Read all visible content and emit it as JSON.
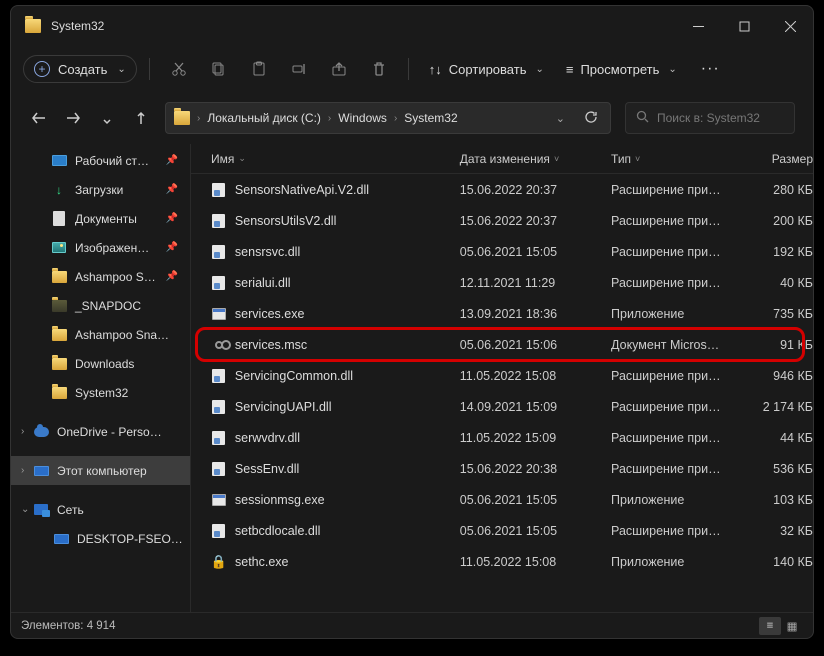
{
  "window": {
    "title": "System32"
  },
  "toolbar": {
    "new_label": "Создать",
    "sort_label": "Сортировать",
    "view_label": "Просмотреть"
  },
  "breadcrumb": {
    "items": [
      "Локальный диск (C:)",
      "Windows",
      "System32"
    ]
  },
  "search": {
    "placeholder": "Поиск в: System32"
  },
  "sidebar": {
    "items": [
      {
        "label": "Рабочий ст…",
        "icon": "desktop"
      },
      {
        "label": "Загрузки",
        "icon": "download"
      },
      {
        "label": "Документы",
        "icon": "doc"
      },
      {
        "label": "Изображен…",
        "icon": "image"
      },
      {
        "label": "Ashampoo S…",
        "icon": "folder"
      },
      {
        "label": "_SNAPDOC",
        "icon": "folder-dark"
      },
      {
        "label": "Ashampoo Sna…",
        "icon": "folder"
      },
      {
        "label": "Downloads",
        "icon": "folder"
      },
      {
        "label": "System32",
        "icon": "folder"
      }
    ],
    "onedrive": "OneDrive - Perso…",
    "thispc": "Этот компьютер",
    "network": "Сеть",
    "desktop_host": "DESKTOP-FSEO…"
  },
  "columns": {
    "name": "Имя",
    "date": "Дата изменения",
    "type": "Тип",
    "size": "Размер"
  },
  "files": [
    {
      "name": "SensorsNativeApi.V2.dll",
      "date": "15.06.2022 20:37",
      "type": "Расширение при…",
      "size": "280 КБ",
      "icon": "dll"
    },
    {
      "name": "SensorsUtilsV2.dll",
      "date": "15.06.2022 20:37",
      "type": "Расширение при…",
      "size": "200 КБ",
      "icon": "dll"
    },
    {
      "name": "sensrsvc.dll",
      "date": "05.06.2021 15:05",
      "type": "Расширение при…",
      "size": "192 КБ",
      "icon": "dll"
    },
    {
      "name": "serialui.dll",
      "date": "12.11.2021 11:29",
      "type": "Расширение при…",
      "size": "40 КБ",
      "icon": "dll"
    },
    {
      "name": "services.exe",
      "date": "13.09.2021 18:36",
      "type": "Приложение",
      "size": "735 КБ",
      "icon": "exe"
    },
    {
      "name": "services.msc",
      "date": "05.06.2021 15:06",
      "type": "Документ Micros…",
      "size": "91 КБ",
      "icon": "msc"
    },
    {
      "name": "ServicingCommon.dll",
      "date": "11.05.2022 15:08",
      "type": "Расширение при…",
      "size": "946 КБ",
      "icon": "dll"
    },
    {
      "name": "ServicingUAPI.dll",
      "date": "14.09.2021 15:09",
      "type": "Расширение при…",
      "size": "2 174 КБ",
      "icon": "dll"
    },
    {
      "name": "serwvdrv.dll",
      "date": "11.05.2022 15:09",
      "type": "Расширение при…",
      "size": "44 КБ",
      "icon": "dll"
    },
    {
      "name": "SessEnv.dll",
      "date": "15.06.2022 20:38",
      "type": "Расширение при…",
      "size": "536 КБ",
      "icon": "dll"
    },
    {
      "name": "sessionmsg.exe",
      "date": "05.06.2021 15:05",
      "type": "Приложение",
      "size": "103 КБ",
      "icon": "exe"
    },
    {
      "name": "setbcdlocale.dll",
      "date": "05.06.2021 15:05",
      "type": "Расширение при…",
      "size": "32 КБ",
      "icon": "dll"
    },
    {
      "name": "sethc.exe",
      "date": "11.05.2022 15:08",
      "type": "Приложение",
      "size": "140 КБ",
      "icon": "lock"
    }
  ],
  "highlighted_index": 5,
  "status": {
    "count_label": "Элементов:",
    "count": "4 914"
  }
}
